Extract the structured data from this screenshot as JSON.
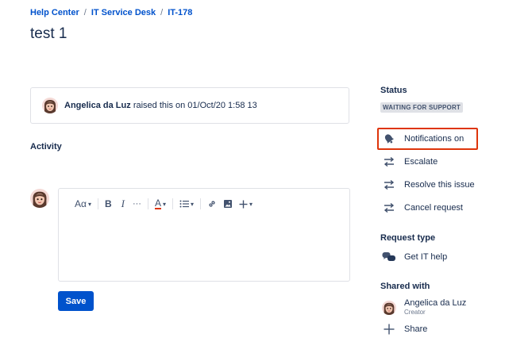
{
  "breadcrumb": {
    "items": [
      "Help Center",
      "IT Service Desk",
      "IT-178"
    ],
    "separator": "/"
  },
  "issue": {
    "title": "test 1"
  },
  "raised": {
    "user": "Angelica da Luz",
    "text": "raised this on 01/Oct/20 1:58 13"
  },
  "activity": {
    "heading": "Activity"
  },
  "editor": {
    "toolbar": {
      "text_style": "Aα",
      "bold": "B",
      "italic": "I",
      "more": "···",
      "text_color": "A"
    },
    "save_label": "Save"
  },
  "sidebar": {
    "status_heading": "Status",
    "status_value": "WAITING FOR SUPPORT",
    "actions": [
      {
        "label": "Notifications on",
        "icon": "bell-icon"
      },
      {
        "label": "Escalate",
        "icon": "transition-arrows-icon"
      },
      {
        "label": "Resolve this issue",
        "icon": "transition-arrows-icon"
      },
      {
        "label": "Cancel request",
        "icon": "transition-arrows-icon"
      }
    ],
    "request_type_heading": "Request type",
    "request_type": "Get IT help",
    "shared_with_heading": "Shared with",
    "shared_user": "Angelica da Luz",
    "shared_role": "Creator",
    "share_label": "Share"
  },
  "colors": {
    "accent": "#0052cc",
    "highlight_border": "#de350b",
    "badge_bg": "#dfe1e6"
  }
}
